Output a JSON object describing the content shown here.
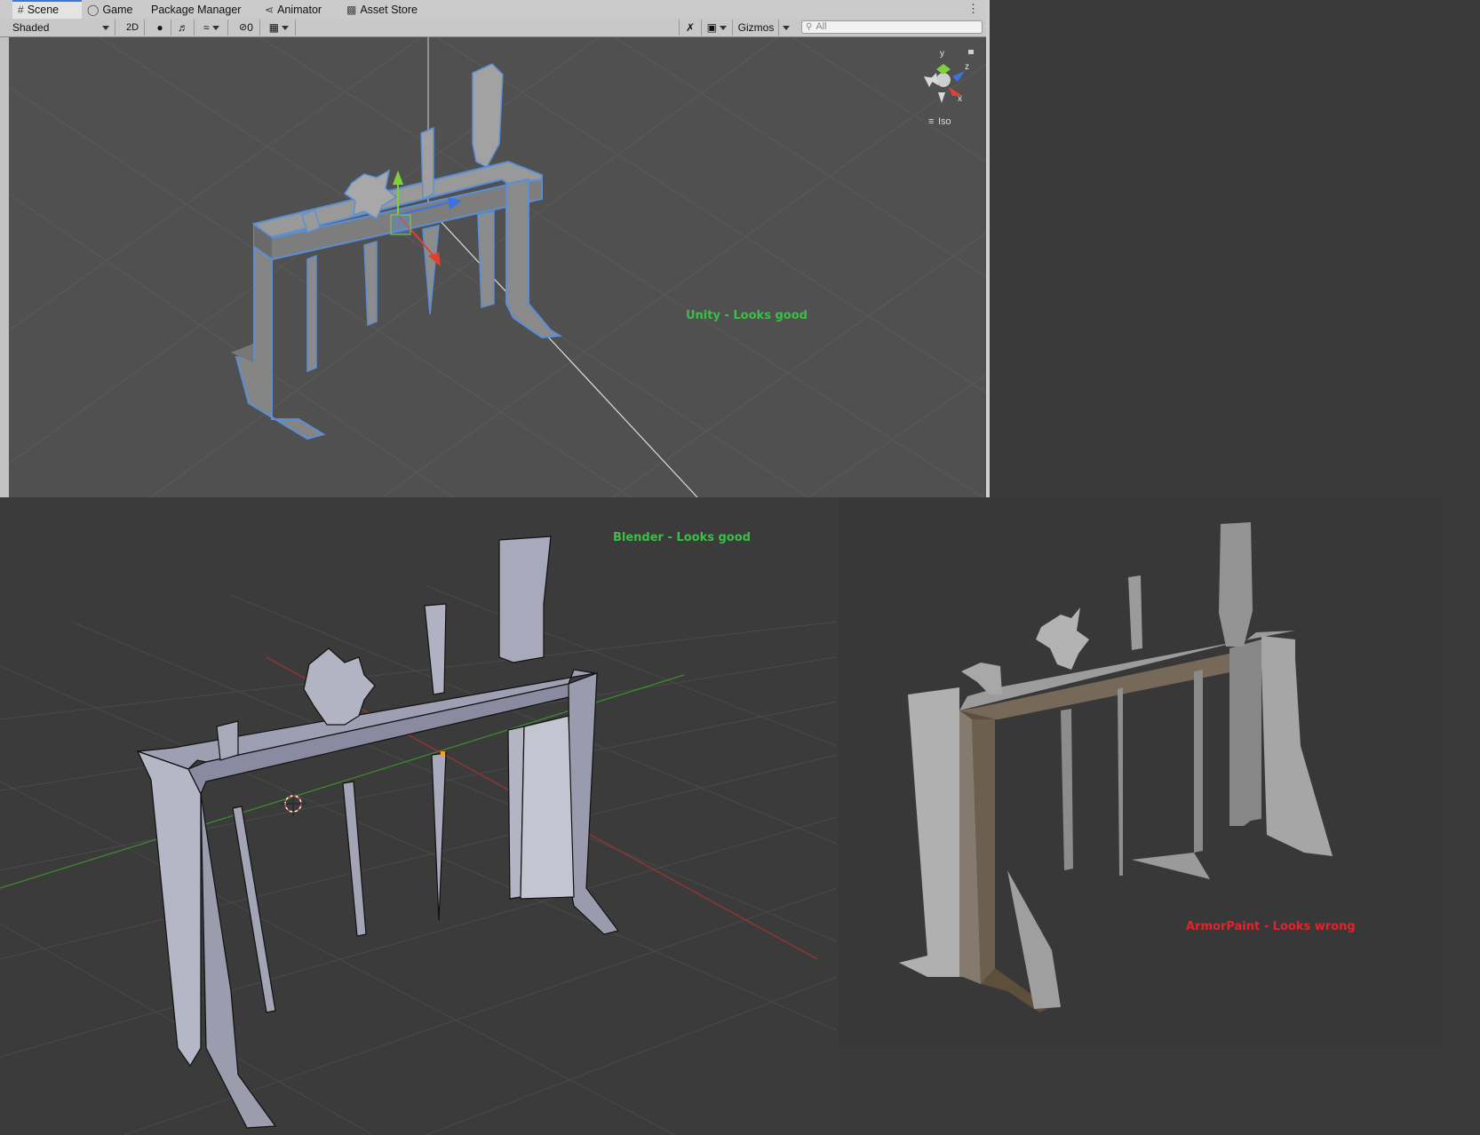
{
  "unity": {
    "tabs": [
      {
        "label": "Scene",
        "icon": "grid-icon"
      },
      {
        "label": "Game",
        "icon": "gamepad-icon"
      },
      {
        "label": "Package Manager",
        "icon": ""
      },
      {
        "label": "Animator",
        "icon": "animator-icon"
      },
      {
        "label": "Asset Store",
        "icon": "bag-icon"
      }
    ],
    "toolbar": {
      "draw_mode": "Shaded",
      "mode_2d": "2D",
      "hidden_count": "0",
      "gizmos": "Gizmos",
      "search_placeholder": "All"
    },
    "orientation_gizmo": {
      "axis_y": "y",
      "axis_z": "z",
      "axis_x": "x",
      "projection": "Iso"
    },
    "caption": "Unity - Looks good"
  },
  "blender": {
    "caption": "Blender - Looks good"
  },
  "armorpaint": {
    "caption": "ArmorPaint - Looks wrong"
  },
  "colors": {
    "good": "#3bbf45",
    "wrong": "#e3232b",
    "selection_outline": "#5a8fd6",
    "gizmo_x": "#e2412f",
    "gizmo_y": "#7fd13b",
    "gizmo_z": "#3b74e0"
  }
}
